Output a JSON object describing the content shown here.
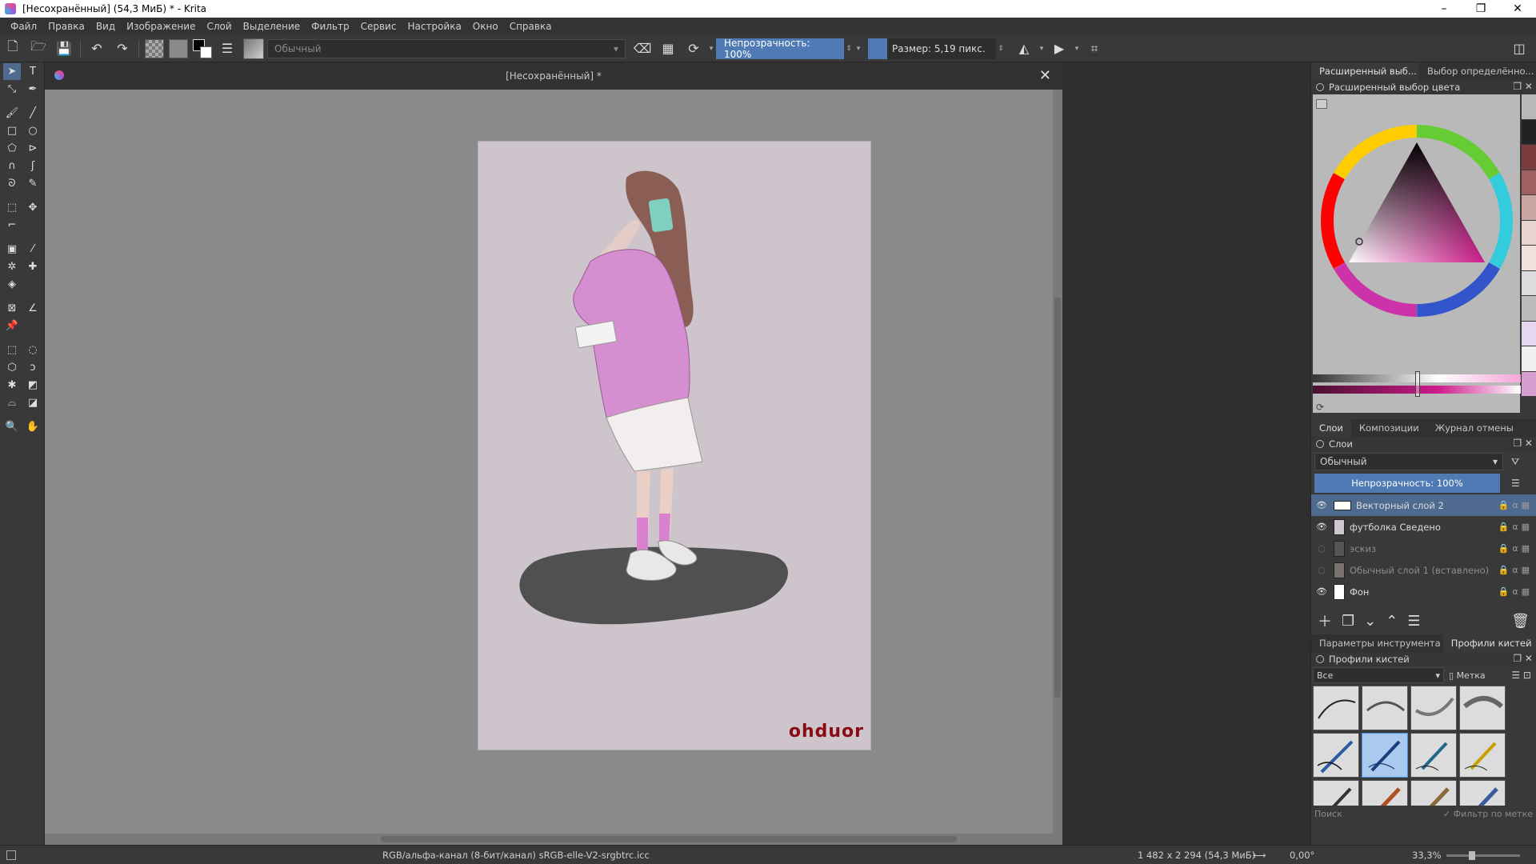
{
  "window": {
    "title": "[Несохранённый] (54,3 МиБ) * - Krita"
  },
  "menu": [
    "Файл",
    "Правка",
    "Вид",
    "Изображение",
    "Слой",
    "Выделение",
    "Фильтр",
    "Сервис",
    "Настройка",
    "Окно",
    "Справка"
  ],
  "toolbar": {
    "blend_mode": "Обычный",
    "opacity_label": "Непрозрачность: 100%",
    "size_label": "Размер: 5,19 пикс."
  },
  "document": {
    "tab_title": "[Несохранённый] *",
    "watermark": "ohduor"
  },
  "dock": {
    "top_tabs": [
      "Расширенный выб...",
      "Выбор определённо..."
    ],
    "color_panel_title": "Расширенный выбор цвета",
    "mid_tabs": [
      "Слои",
      "Композиции",
      "Журнал отмены"
    ],
    "layers_panel_title": "Слои",
    "layers_blend": "Обычный",
    "layers_opacity": "Непрозрачность:  100%",
    "layers": [
      {
        "name": "Векторный слой 2",
        "visible": true,
        "selected": true
      },
      {
        "name": "футболка Сведено",
        "visible": true,
        "selected": false
      },
      {
        "name": "эскиз",
        "visible": false,
        "selected": false
      },
      {
        "name": "Обычный слой 1 (вставлено)",
        "visible": false,
        "selected": false
      },
      {
        "name": "Фон",
        "visible": true,
        "selected": false
      }
    ],
    "bottom_tabs": [
      "Параметры инструмента",
      "Профили кистей"
    ],
    "brush_panel_title": "Профили кистей",
    "brush_filter": "Все",
    "brush_tag": "Метка",
    "brush_search": "Поиск",
    "brush_filter_by_tag": "Фильтр по метке"
  },
  "status": {
    "color_profile": "RGB/альфа-канал (8-бит/канал)  sRGB-elle-V2-srgbtrc.icc",
    "dimensions": "1 482 x 2 294 (54,3 МиБ)",
    "rotation": "0,00°",
    "zoom": "33,3%"
  },
  "colors": {
    "accent": "#4f7ab3",
    "selection": "#4f6a8f",
    "canvas_bg": "#cdc4cc",
    "shirt": "#d58ecf",
    "hair": "#8b5e55"
  }
}
